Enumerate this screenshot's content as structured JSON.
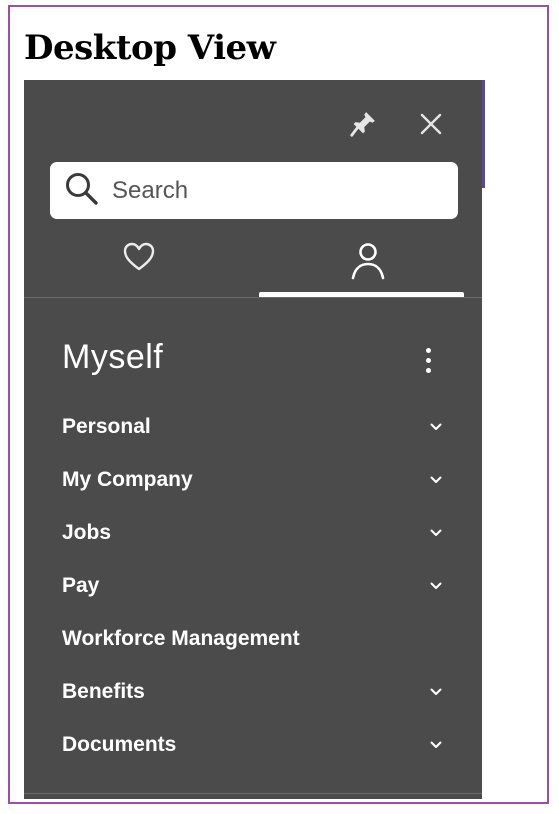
{
  "page": {
    "title": "Desktop View"
  },
  "panel": {
    "toolbar": {
      "pin_icon": "pin-icon",
      "close_icon": "close-icon"
    },
    "search": {
      "placeholder": "Search",
      "icon": "search-icon"
    },
    "tabs": [
      {
        "name": "favorites",
        "icon": "heart-icon",
        "selected": false
      },
      {
        "name": "myself",
        "icon": "person-icon",
        "selected": true
      }
    ],
    "section": {
      "title": "Myself",
      "menu_icon": "more-vertical-icon"
    },
    "items": [
      {
        "label": "Personal",
        "expandable": true
      },
      {
        "label": "My Company",
        "expandable": true
      },
      {
        "label": "Jobs",
        "expandable": true
      },
      {
        "label": "Pay",
        "expandable": true
      },
      {
        "label": "Workforce Management",
        "expandable": false
      },
      {
        "label": "Benefits",
        "expandable": true
      },
      {
        "label": "Documents",
        "expandable": true
      }
    ]
  },
  "colors": {
    "panel_bg": "#4b4b4b",
    "frame_border": "#9c4fa6",
    "text_light": "#ffffff"
  }
}
